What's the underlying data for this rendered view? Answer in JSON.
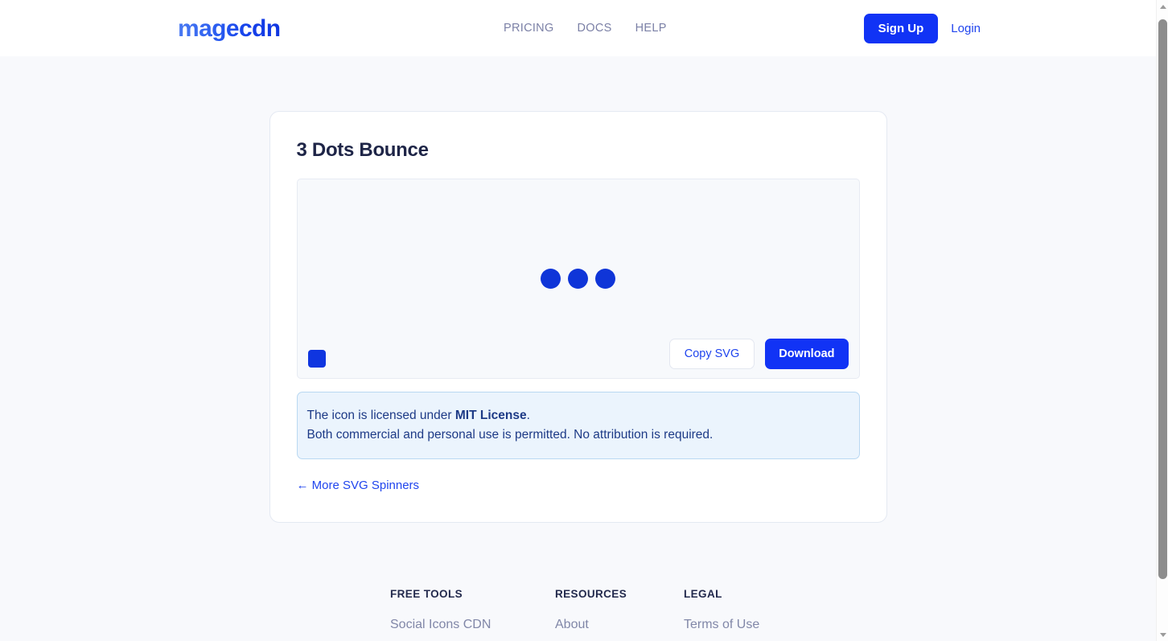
{
  "header": {
    "logo_text": "magecdn",
    "nav": [
      {
        "label": "PRICING"
      },
      {
        "label": "DOCS"
      },
      {
        "label": "HELP"
      }
    ],
    "signup_label": "Sign Up",
    "login_label": "Login"
  },
  "card": {
    "title": "3 Dots Bounce",
    "preview": {
      "spinner_name": "three-dots-bounce",
      "dot_count": 3,
      "dot_color": "#0f35d8",
      "color_swatch_value": "#0f35e0"
    },
    "copy_label": "Copy SVG",
    "download_label": "Download",
    "license": {
      "line1_prefix": "The icon is licensed under ",
      "line1_link": "MIT License",
      "line1_suffix": ".",
      "line2": "Both commercial and personal use is permitted. No attribution is required."
    },
    "back_link": "← More SVG Spinners"
  },
  "footer": {
    "columns": [
      {
        "heading": "FREE TOOLS",
        "links": [
          {
            "label": "Social Icons CDN"
          }
        ]
      },
      {
        "heading": "RESOURCES",
        "links": [
          {
            "label": "About"
          }
        ]
      },
      {
        "heading": "LEGAL",
        "links": [
          {
            "label": "Terms of Use"
          }
        ]
      }
    ]
  },
  "theme": {
    "accent_blue": "#1133f5",
    "link_blue": "#1f44ee",
    "page_bg": "#f8f9fc",
    "card_bg": "#ffffff",
    "notice_bg": "#ebf4fd",
    "notice_border": "#b9d8f2"
  }
}
